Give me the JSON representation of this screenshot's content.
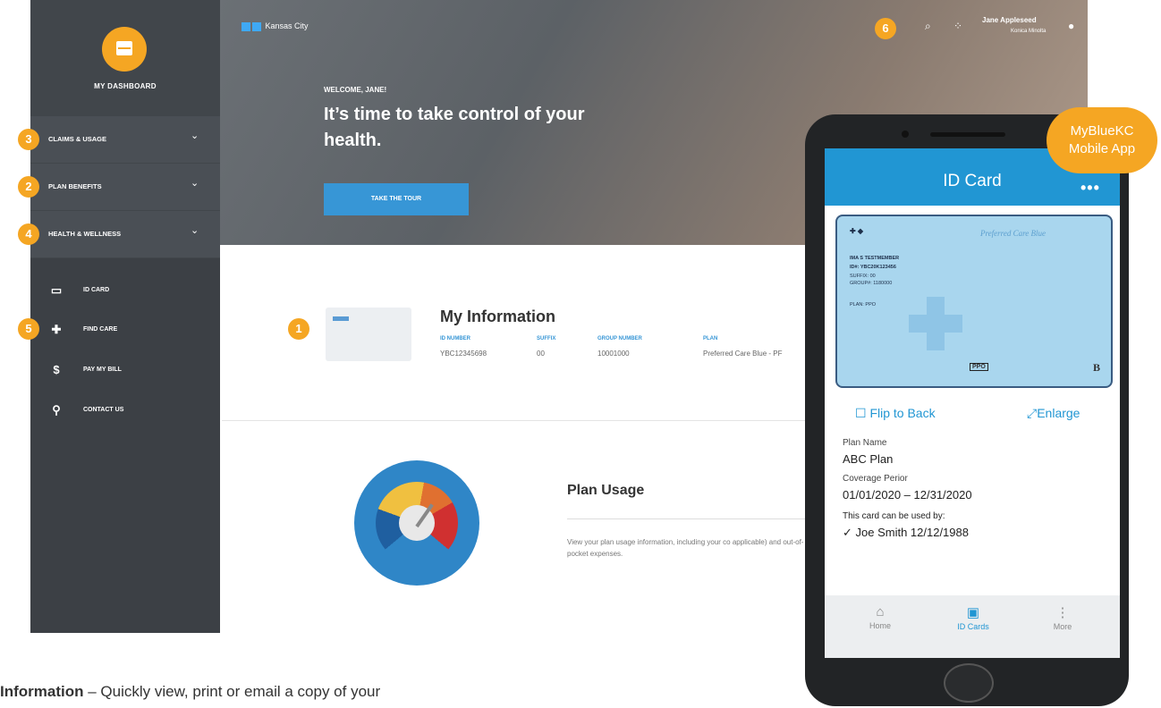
{
  "sidebar": {
    "dashboard_label": "MY DASHBOARD",
    "sections": [
      {
        "label": "CLAIMS & USAGE",
        "badge": "3"
      },
      {
        "label": "PLAN BENEFITS",
        "badge": "2"
      },
      {
        "label": "HEALTH & WELLNESS",
        "badge": "4"
      }
    ],
    "links": [
      {
        "label": "ID CARD",
        "icon": "id-card-icon"
      },
      {
        "label": "FIND CARE",
        "icon": "plus-icon",
        "badge": "5"
      },
      {
        "label": "PAY MY BILL",
        "icon": "dollar-icon"
      },
      {
        "label": "CONTACT US",
        "icon": "location-pin-icon"
      }
    ]
  },
  "header": {
    "logo_text": "Kansas City",
    "badge": "6",
    "user_name": "Jane Appleseed",
    "user_sub": "Konica Minolta"
  },
  "hero": {
    "welcome": "WELCOME, JANE!",
    "headline": "It’s time to take control of your health.",
    "button": "TAKE THE TOUR"
  },
  "my_info": {
    "badge": "1",
    "title": "My Information",
    "fields": [
      {
        "label": "ID NUMBER",
        "value": "YBC12345698"
      },
      {
        "label": "SUFFIX",
        "value": "00"
      },
      {
        "label": "GROUP NUMBER",
        "value": "10001000"
      },
      {
        "label": "PLAN",
        "value": "Preferred Care Blue - PF"
      }
    ]
  },
  "plan_usage": {
    "title": "Plan Usage",
    "description": "View your plan usage information, including your co applicable) and out-of-pocket expenses."
  },
  "caption": {
    "bold": "Information",
    "text": " – Quickly view, print or email a copy of your"
  },
  "mobile": {
    "badge_line1": "MyBlueKC",
    "badge_line2": "Mobile App",
    "title": "ID Card",
    "card": {
      "name": "IMA S TESTMEMBER",
      "id": "ID#: YBC20K123456",
      "suffix": "SUFFIX: 00",
      "group": "GROUP#: 1180000",
      "plan": "PLAN: PPO",
      "logo_title": "Preferred Care Blue",
      "rx": "B",
      "ppo": "PPO"
    },
    "flip_label": "Flip to Back",
    "enlarge_label": "Enlarge",
    "plan_name_label": "Plan Name",
    "plan_name": "ABC Plan",
    "coverage_label": "Coverage Perior",
    "coverage": "01/01/2020 – 12/31/2020",
    "used_by_label": "This card can be used by:",
    "used_by": "✓ Joe Smith 12/12/1988",
    "tabs": [
      {
        "label": "Home",
        "icon": "home-icon"
      },
      {
        "label": "ID Cards",
        "icon": "id-card-icon"
      },
      {
        "label": "More",
        "icon": "more-vertical-icon"
      }
    ]
  }
}
